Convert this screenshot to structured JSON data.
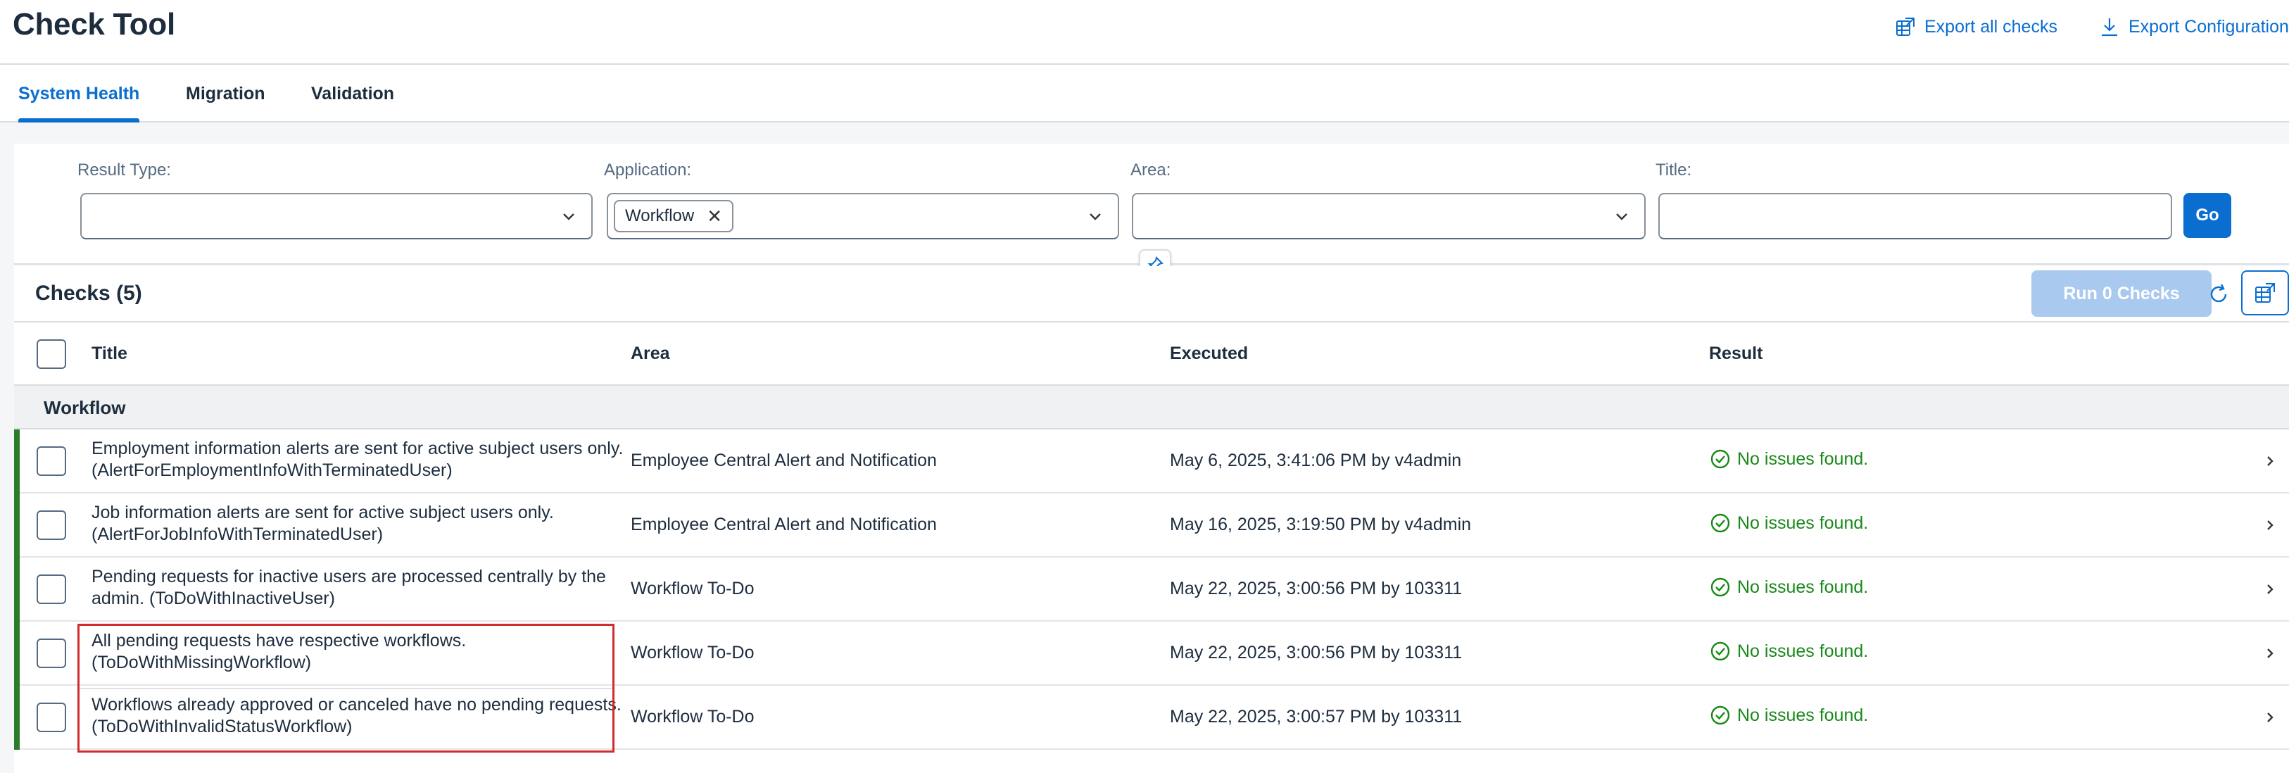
{
  "app": {
    "title": "Check Tool"
  },
  "header": {
    "export_all_label": "Export all checks",
    "export_config_label": "Export Configuration"
  },
  "tabs": [
    {
      "label": "System Health",
      "active": true
    },
    {
      "label": "Migration",
      "active": false
    },
    {
      "label": "Validation",
      "active": false
    }
  ],
  "filters": {
    "result_type": {
      "label": "Result Type:",
      "value": ""
    },
    "application": {
      "label": "Application:",
      "tokens": [
        "Workflow"
      ]
    },
    "area": {
      "label": "Area:",
      "value": ""
    },
    "title": {
      "label": "Title:",
      "value": ""
    },
    "go_label": "Go"
  },
  "table": {
    "heading": "Checks (5)",
    "run_label": "Run 0 Checks",
    "columns": [
      "Title",
      "Area",
      "Executed",
      "Result"
    ],
    "group_label": "Workflow",
    "rows": [
      {
        "title": "Employment information alerts are sent for active subject users only. (AlertForEmploymentInfoWithTerminatedUser)",
        "area": "Employee Central Alert and Notification",
        "executed": "May 6, 2025, 3:41:06 PM by v4admin",
        "result": "No issues found."
      },
      {
        "title": "Job information alerts are sent for active subject users only. (AlertForJobInfoWithTerminatedUser)",
        "area": "Employee Central Alert and Notification",
        "executed": "May 16, 2025, 3:19:50 PM by v4admin",
        "result": "No issues found."
      },
      {
        "title": "Pending requests for inactive users are processed centrally by the admin. (ToDoWithInactiveUser)",
        "area": "Workflow To-Do",
        "executed": "May 22, 2025, 3:00:56 PM by 103311",
        "result": "No issues found."
      },
      {
        "title": "All pending requests have respective workflows. (ToDoWithMissingWorkflow)",
        "area": "Workflow To-Do",
        "executed": "May 22, 2025, 3:00:56 PM by 103311",
        "result": "No issues found."
      },
      {
        "title": "Workflows already approved or canceled have no pending requests. (ToDoWithInvalidStatusWorkflow)",
        "area": "Workflow To-Do",
        "executed": "May 22, 2025, 3:00:57 PM by 103311",
        "result": "No issues found."
      }
    ]
  },
  "colors": {
    "accent": "#0a6ed1",
    "success": "#188918",
    "status_bar": "#2b7d2b",
    "highlight": "#d22d2d"
  },
  "icons": {
    "export_all": "spreadsheet-export-icon",
    "export_config": "download-icon",
    "pin": "pin-icon",
    "refresh": "refresh-icon",
    "result": "check-circle-icon",
    "row_nav": "chevron-right-icon"
  }
}
